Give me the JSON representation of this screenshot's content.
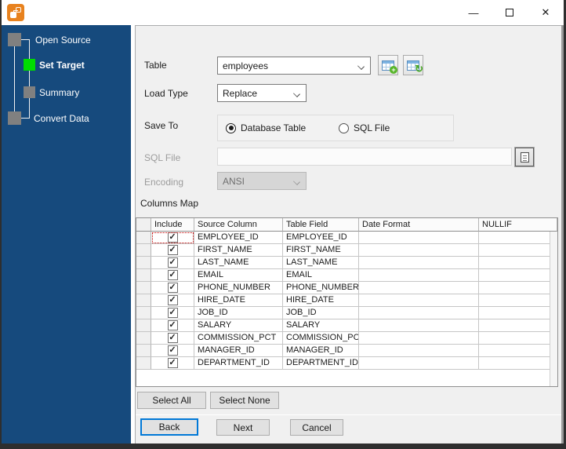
{
  "window": {
    "controls": {
      "minimize": "—",
      "close": "✕"
    }
  },
  "sidebar": {
    "steps": [
      {
        "label": "Open Source",
        "state": "done"
      },
      {
        "label": "Set Target",
        "state": "active"
      },
      {
        "label": "Summary",
        "state": "pending"
      },
      {
        "label": "Convert Data",
        "state": "pending"
      }
    ]
  },
  "form": {
    "table": {
      "label": "Table",
      "value": "employees"
    },
    "load_type": {
      "label": "Load Type",
      "value": "Replace"
    },
    "save_to": {
      "label": "Save To",
      "options": [
        {
          "label": "Database Table",
          "selected": true
        },
        {
          "label": "SQL File",
          "selected": false
        }
      ]
    },
    "sql_file": {
      "label": "SQL File",
      "value": "",
      "disabled": true
    },
    "encoding": {
      "label": "Encoding",
      "value": "ANSI",
      "disabled": true
    }
  },
  "columns_map": {
    "title": "Columns Map",
    "headers": [
      "Include",
      "Source Column",
      "Table Field",
      "Date Format",
      "NULLIF"
    ],
    "rows": [
      {
        "include": true,
        "source": "EMPLOYEE_ID",
        "field": "EMPLOYEE_ID",
        "date_format": "",
        "nullif": ""
      },
      {
        "include": true,
        "source": "FIRST_NAME",
        "field": "FIRST_NAME",
        "date_format": "",
        "nullif": ""
      },
      {
        "include": true,
        "source": "LAST_NAME",
        "field": "LAST_NAME",
        "date_format": "",
        "nullif": ""
      },
      {
        "include": true,
        "source": "EMAIL",
        "field": "EMAIL",
        "date_format": "",
        "nullif": ""
      },
      {
        "include": true,
        "source": "PHONE_NUMBER",
        "field": "PHONE_NUMBER",
        "date_format": "",
        "nullif": ""
      },
      {
        "include": true,
        "source": "HIRE_DATE",
        "field": "HIRE_DATE",
        "date_format": "",
        "nullif": ""
      },
      {
        "include": true,
        "source": "JOB_ID",
        "field": "JOB_ID",
        "date_format": "",
        "nullif": ""
      },
      {
        "include": true,
        "source": "SALARY",
        "field": "SALARY",
        "date_format": "",
        "nullif": ""
      },
      {
        "include": true,
        "source": "COMMISSION_PCT",
        "field": "COMMISSION_PC",
        "date_format": "",
        "nullif": ""
      },
      {
        "include": true,
        "source": "MANAGER_ID",
        "field": "MANAGER_ID",
        "date_format": "",
        "nullif": ""
      },
      {
        "include": true,
        "source": "DEPARTMENT_ID",
        "field": "DEPARTMENT_ID",
        "date_format": "",
        "nullif": ""
      }
    ]
  },
  "buttons": {
    "select_all": "Select All",
    "select_none": "Select None",
    "back": "Back",
    "next": "Next",
    "cancel": "Cancel"
  },
  "colors": {
    "sidebar_bg": "#164a7d",
    "active_step": "#00dc00",
    "inactive_step": "#808080",
    "focus_border": "#0078d7",
    "app_icon": "#e8821e"
  }
}
